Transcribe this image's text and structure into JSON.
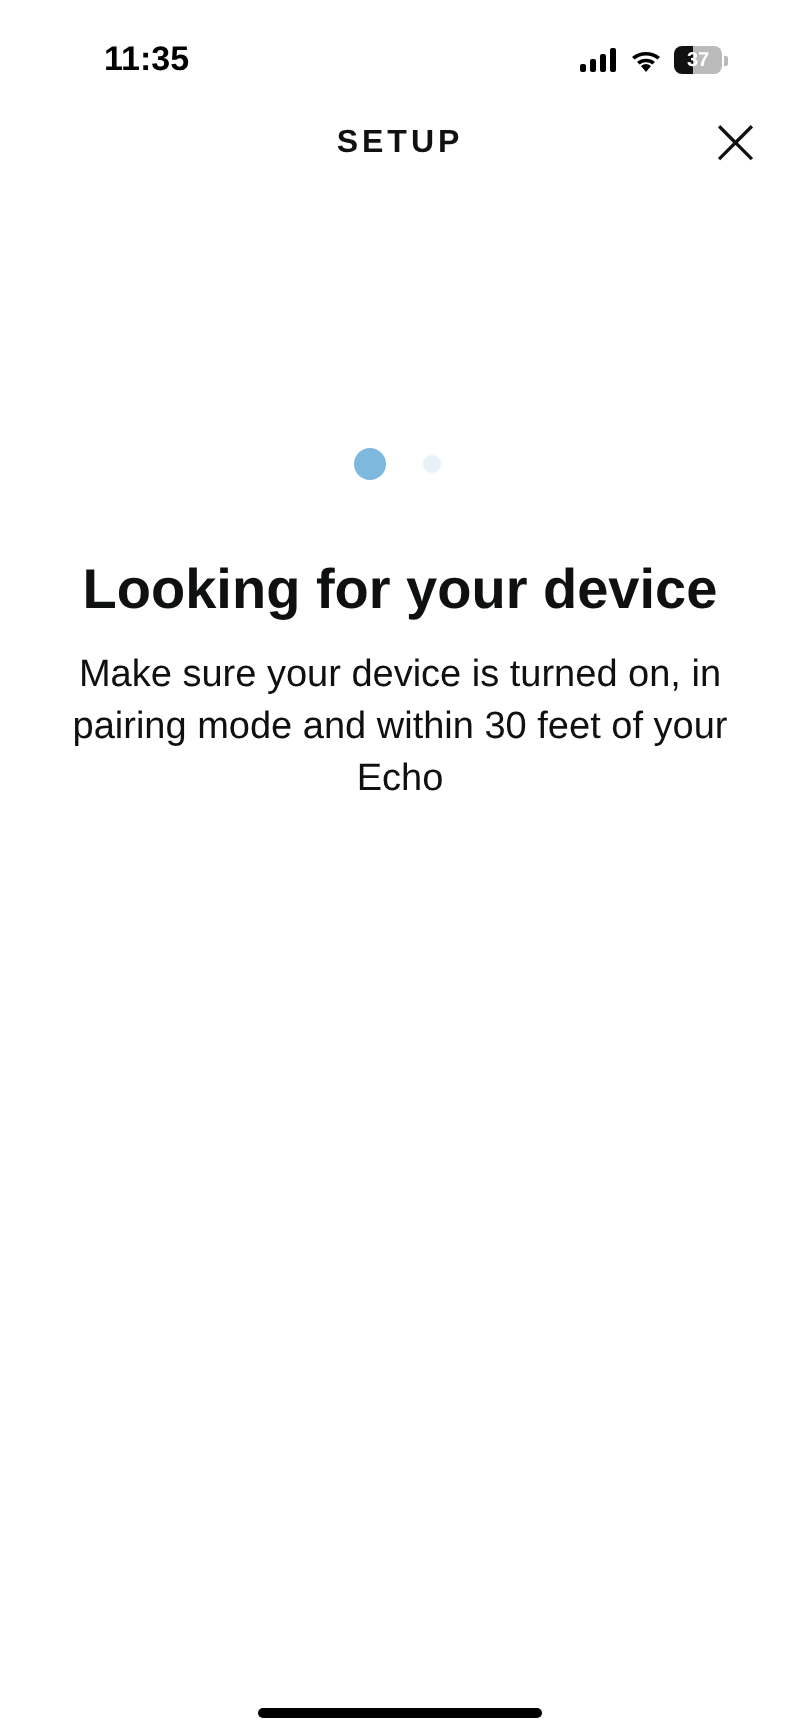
{
  "status_bar": {
    "time": "11:35",
    "battery": "37"
  },
  "header": {
    "title": "SETUP",
    "close": "×"
  },
  "content": {
    "heading": "Looking for your device",
    "message": "Make sure your device is turned on, in pairing mode and within 30 feet of your Echo"
  }
}
